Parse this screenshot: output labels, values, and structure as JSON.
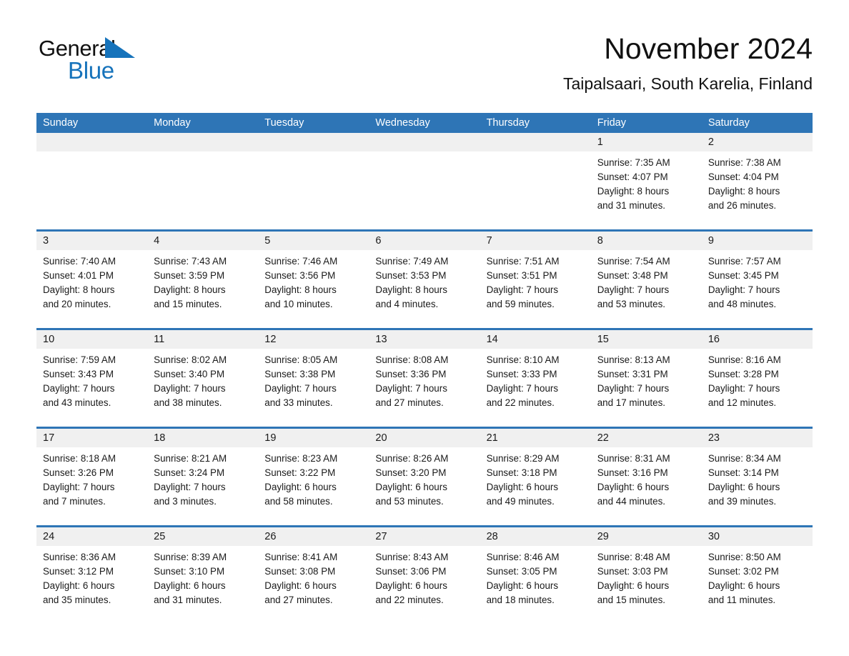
{
  "brand": {
    "name_part1": "General",
    "name_part2": "Blue",
    "accent_color": "#1673bb"
  },
  "header": {
    "title": "November 2024",
    "subtitle": "Taipalsaari, South Karelia, Finland"
  },
  "theme": {
    "header_bar_color": "#2e75b6",
    "date_strip_color": "#f0f0f0",
    "text_color": "#1a1a1a",
    "page_background": "#ffffff"
  },
  "weekdays": [
    "Sunday",
    "Monday",
    "Tuesday",
    "Wednesday",
    "Thursday",
    "Friday",
    "Saturday"
  ],
  "weeks": [
    [
      {
        "day": "",
        "sunrise": "",
        "sunset": "",
        "daylight_line1": "",
        "daylight_line2": "",
        "empty": true
      },
      {
        "day": "",
        "sunrise": "",
        "sunset": "",
        "daylight_line1": "",
        "daylight_line2": "",
        "empty": true
      },
      {
        "day": "",
        "sunrise": "",
        "sunset": "",
        "daylight_line1": "",
        "daylight_line2": "",
        "empty": true
      },
      {
        "day": "",
        "sunrise": "",
        "sunset": "",
        "daylight_line1": "",
        "daylight_line2": "",
        "empty": true
      },
      {
        "day": "",
        "sunrise": "",
        "sunset": "",
        "daylight_line1": "",
        "daylight_line2": "",
        "empty": true
      },
      {
        "day": "1",
        "sunrise": "Sunrise: 7:35 AM",
        "sunset": "Sunset: 4:07 PM",
        "daylight_line1": "Daylight: 8 hours",
        "daylight_line2": "and 31 minutes."
      },
      {
        "day": "2",
        "sunrise": "Sunrise: 7:38 AM",
        "sunset": "Sunset: 4:04 PM",
        "daylight_line1": "Daylight: 8 hours",
        "daylight_line2": "and 26 minutes."
      }
    ],
    [
      {
        "day": "3",
        "sunrise": "Sunrise: 7:40 AM",
        "sunset": "Sunset: 4:01 PM",
        "daylight_line1": "Daylight: 8 hours",
        "daylight_line2": "and 20 minutes."
      },
      {
        "day": "4",
        "sunrise": "Sunrise: 7:43 AM",
        "sunset": "Sunset: 3:59 PM",
        "daylight_line1": "Daylight: 8 hours",
        "daylight_line2": "and 15 minutes."
      },
      {
        "day": "5",
        "sunrise": "Sunrise: 7:46 AM",
        "sunset": "Sunset: 3:56 PM",
        "daylight_line1": "Daylight: 8 hours",
        "daylight_line2": "and 10 minutes."
      },
      {
        "day": "6",
        "sunrise": "Sunrise: 7:49 AM",
        "sunset": "Sunset: 3:53 PM",
        "daylight_line1": "Daylight: 8 hours",
        "daylight_line2": "and 4 minutes."
      },
      {
        "day": "7",
        "sunrise": "Sunrise: 7:51 AM",
        "sunset": "Sunset: 3:51 PM",
        "daylight_line1": "Daylight: 7 hours",
        "daylight_line2": "and 59 minutes."
      },
      {
        "day": "8",
        "sunrise": "Sunrise: 7:54 AM",
        "sunset": "Sunset: 3:48 PM",
        "daylight_line1": "Daylight: 7 hours",
        "daylight_line2": "and 53 minutes."
      },
      {
        "day": "9",
        "sunrise": "Sunrise: 7:57 AM",
        "sunset": "Sunset: 3:45 PM",
        "daylight_line1": "Daylight: 7 hours",
        "daylight_line2": "and 48 minutes."
      }
    ],
    [
      {
        "day": "10",
        "sunrise": "Sunrise: 7:59 AM",
        "sunset": "Sunset: 3:43 PM",
        "daylight_line1": "Daylight: 7 hours",
        "daylight_line2": "and 43 minutes."
      },
      {
        "day": "11",
        "sunrise": "Sunrise: 8:02 AM",
        "sunset": "Sunset: 3:40 PM",
        "daylight_line1": "Daylight: 7 hours",
        "daylight_line2": "and 38 minutes."
      },
      {
        "day": "12",
        "sunrise": "Sunrise: 8:05 AM",
        "sunset": "Sunset: 3:38 PM",
        "daylight_line1": "Daylight: 7 hours",
        "daylight_line2": "and 33 minutes."
      },
      {
        "day": "13",
        "sunrise": "Sunrise: 8:08 AM",
        "sunset": "Sunset: 3:36 PM",
        "daylight_line1": "Daylight: 7 hours",
        "daylight_line2": "and 27 minutes."
      },
      {
        "day": "14",
        "sunrise": "Sunrise: 8:10 AM",
        "sunset": "Sunset: 3:33 PM",
        "daylight_line1": "Daylight: 7 hours",
        "daylight_line2": "and 22 minutes."
      },
      {
        "day": "15",
        "sunrise": "Sunrise: 8:13 AM",
        "sunset": "Sunset: 3:31 PM",
        "daylight_line1": "Daylight: 7 hours",
        "daylight_line2": "and 17 minutes."
      },
      {
        "day": "16",
        "sunrise": "Sunrise: 8:16 AM",
        "sunset": "Sunset: 3:28 PM",
        "daylight_line1": "Daylight: 7 hours",
        "daylight_line2": "and 12 minutes."
      }
    ],
    [
      {
        "day": "17",
        "sunrise": "Sunrise: 8:18 AM",
        "sunset": "Sunset: 3:26 PM",
        "daylight_line1": "Daylight: 7 hours",
        "daylight_line2": "and 7 minutes."
      },
      {
        "day": "18",
        "sunrise": "Sunrise: 8:21 AM",
        "sunset": "Sunset: 3:24 PM",
        "daylight_line1": "Daylight: 7 hours",
        "daylight_line2": "and 3 minutes."
      },
      {
        "day": "19",
        "sunrise": "Sunrise: 8:23 AM",
        "sunset": "Sunset: 3:22 PM",
        "daylight_line1": "Daylight: 6 hours",
        "daylight_line2": "and 58 minutes."
      },
      {
        "day": "20",
        "sunrise": "Sunrise: 8:26 AM",
        "sunset": "Sunset: 3:20 PM",
        "daylight_line1": "Daylight: 6 hours",
        "daylight_line2": "and 53 minutes."
      },
      {
        "day": "21",
        "sunrise": "Sunrise: 8:29 AM",
        "sunset": "Sunset: 3:18 PM",
        "daylight_line1": "Daylight: 6 hours",
        "daylight_line2": "and 49 minutes."
      },
      {
        "day": "22",
        "sunrise": "Sunrise: 8:31 AM",
        "sunset": "Sunset: 3:16 PM",
        "daylight_line1": "Daylight: 6 hours",
        "daylight_line2": "and 44 minutes."
      },
      {
        "day": "23",
        "sunrise": "Sunrise: 8:34 AM",
        "sunset": "Sunset: 3:14 PM",
        "daylight_line1": "Daylight: 6 hours",
        "daylight_line2": "and 39 minutes."
      }
    ],
    [
      {
        "day": "24",
        "sunrise": "Sunrise: 8:36 AM",
        "sunset": "Sunset: 3:12 PM",
        "daylight_line1": "Daylight: 6 hours",
        "daylight_line2": "and 35 minutes."
      },
      {
        "day": "25",
        "sunrise": "Sunrise: 8:39 AM",
        "sunset": "Sunset: 3:10 PM",
        "daylight_line1": "Daylight: 6 hours",
        "daylight_line2": "and 31 minutes."
      },
      {
        "day": "26",
        "sunrise": "Sunrise: 8:41 AM",
        "sunset": "Sunset: 3:08 PM",
        "daylight_line1": "Daylight: 6 hours",
        "daylight_line2": "and 27 minutes."
      },
      {
        "day": "27",
        "sunrise": "Sunrise: 8:43 AM",
        "sunset": "Sunset: 3:06 PM",
        "daylight_line1": "Daylight: 6 hours",
        "daylight_line2": "and 22 minutes."
      },
      {
        "day": "28",
        "sunrise": "Sunrise: 8:46 AM",
        "sunset": "Sunset: 3:05 PM",
        "daylight_line1": "Daylight: 6 hours",
        "daylight_line2": "and 18 minutes."
      },
      {
        "day": "29",
        "sunrise": "Sunrise: 8:48 AM",
        "sunset": "Sunset: 3:03 PM",
        "daylight_line1": "Daylight: 6 hours",
        "daylight_line2": "and 15 minutes."
      },
      {
        "day": "30",
        "sunrise": "Sunrise: 8:50 AM",
        "sunset": "Sunset: 3:02 PM",
        "daylight_line1": "Daylight: 6 hours",
        "daylight_line2": "and 11 minutes."
      }
    ]
  ]
}
